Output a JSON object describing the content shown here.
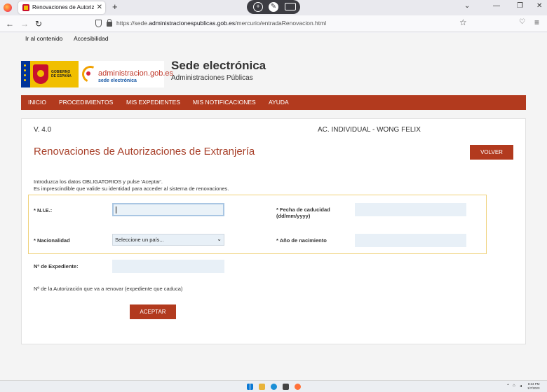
{
  "browser": {
    "tab_title": "Renovaciones de Autorizaciones",
    "url_prefix": "https://sede.",
    "url_domain": "administracionespublicas.gob.es",
    "url_path": "/mercurio/entradaRenovacion.html"
  },
  "skip_links": {
    "content": "Ir al contenido",
    "accessibility": "Accesibilidad"
  },
  "header": {
    "gob_line1": "GOBIERNO",
    "gob_line2": "DE ESPAÑA",
    "admin_logo_name": "administracion.gob.es",
    "admin_logo_sub": "sede electrónica",
    "site_title": "Sede electrónica",
    "site_subtitle": "Administraciones Públicas"
  },
  "nav": {
    "items": [
      "INICIO",
      "PROCEDIMIENTOS",
      "MIS EXPEDIENTES",
      "MIS NOTIFICACIONES",
      "AYUDA"
    ]
  },
  "form": {
    "version": "V. 4.0",
    "user": "AC. INDIVIDUAL - WONG FELIX",
    "title": "Renovaciones de Autorizaciones de Extranjería",
    "back_label": "VOLVER",
    "intro_line1": "Introduzca los datos OBLIGATORIOS y pulse 'Aceptar'.",
    "intro_line2": "Es imprescindible que valide su identidad para acceder al sistema de renovaciones.",
    "nie_label": "* N.I.E.:",
    "nie_value": "",
    "expiry_label_line1": "* Fecha de caducidad",
    "expiry_label_line2": "(dd/mm/yyyy)",
    "expiry_value": "",
    "nationality_label": "* Nacionalidad",
    "nationality_selected": "Seleccione un país...",
    "birth_year_label": "* Año de nacimiento",
    "birth_year_value": "",
    "file_number_label": "Nº de Expediente:",
    "file_number_value": "",
    "note": "Nº de la Autorización que va a renovar (expediente que caduca)",
    "accept_label": "ACEPTAR"
  },
  "taskbar": {
    "time": "8:34 PM",
    "date": "1/7/2023"
  }
}
